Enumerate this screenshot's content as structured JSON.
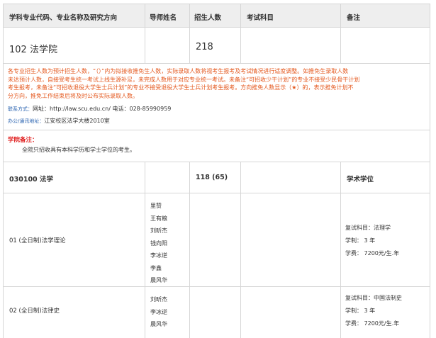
{
  "headers": [
    "学科专业代码、专业名称及研究方向",
    "导师姓名",
    "招生人数",
    "考试科目",
    "备注"
  ],
  "school": {
    "name": "102 法学院",
    "quota": "218"
  },
  "notice_lines": [
    "各专业招生人数为预计招生人数，“（）”内为拟接收推免生人数，实际录取人数将视考生报考及考试情况进行适度调整。如推免生录取人数",
    "未达预计人数，自接受考生统一考试上线生源补足，未完成人数用于对应专业统一考试。未备注“可招收少干计划”的专业不接受少民骨干计划",
    "考生报考，未备注“可招收退役大学生士兵计划”的专业不接受退役大学生士兵计划考生报考。方向推免人数显示（★）的，表示推免计划不",
    "分方向，推免工作结束后将及时公布实际录取人数。"
  ],
  "contact": {
    "label": "联系方式：",
    "website_label": "网址：",
    "website": "http://law.scu.edu.cn/",
    "phone_label": "电话：",
    "phone": "028-85990959"
  },
  "address": {
    "label": "办公/通讯地址：",
    "value": "江安校区法学大楼2010室"
  },
  "remark": {
    "title": "学院备注：",
    "text": "全院只招收具有本科学历和学士学位的考生。"
  },
  "major": {
    "name": "030100 法学",
    "quota": "118 (65)",
    "degree": "学术学位"
  },
  "directions": [
    {
      "name": "01 (全日制)法学理论",
      "tutors": [
        "里赞",
        "王有粮",
        "刘昕杰",
        "钱向阳",
        "李冰逆",
        "李鑫",
        "晨风华"
      ],
      "retest": "复试科目：法理学",
      "duration": "学制： 3 年",
      "fee": "学费： 7200元/生.年"
    },
    {
      "name": "02 (全日制)法律史",
      "tutors": [
        "刘昕杰",
        "李冰逆",
        "晨风华"
      ],
      "retest": "复试科目：中国法制史",
      "duration": "学制： 3 年",
      "fee": "学费： 7200元/生.年"
    }
  ]
}
